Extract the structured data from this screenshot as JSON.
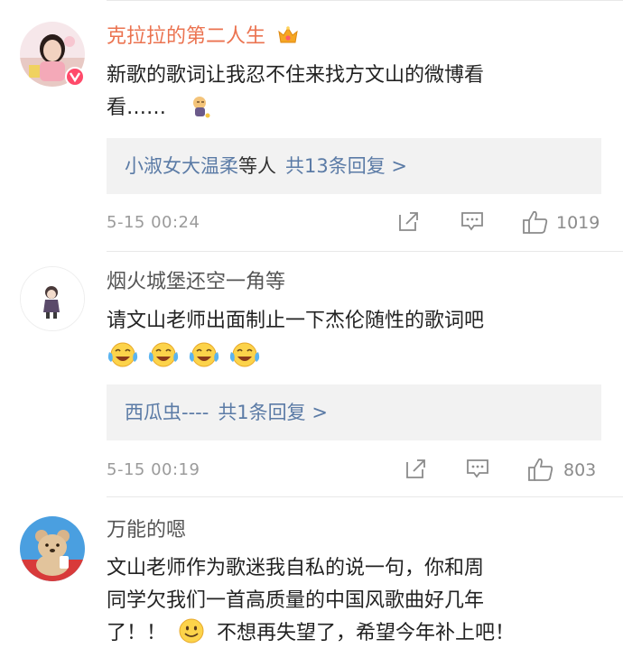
{
  "comments": [
    {
      "username": "克拉拉的第二人生",
      "text_line1": "新歌的歌词让我忍不住来找方文山的微博看",
      "text_line2": "看……",
      "reply_names": "小淑女大温柔",
      "reply_suffix": "等人",
      "reply_count": "共13条回复 >",
      "time": "5-15 00:24",
      "likes": "1019"
    },
    {
      "username": "烟火城堡还空一角等",
      "text_line1": "请文山老师出面制止一下杰伦随性的歌词吧",
      "reply_names": "西瓜虫----",
      "reply_count": "共1条回复 >",
      "time": "5-15 00:19",
      "likes": "803"
    },
    {
      "username": "万能的嗯",
      "text_line1": "文山老师作为歌迷我自私的说一句，你和周",
      "text_line2": "同学欠我们一首高质量的中国风歌曲好几年",
      "text_line3_a": "了！！",
      "text_line3_b": "不想再失望了，希望今年补上吧！"
    }
  ],
  "colors": {
    "vip_name": "#eb7350",
    "link_blue": "#5b7ba6",
    "reply_bg": "#f2f2f2",
    "meta_gray": "#9b9b9b"
  },
  "icons": [
    "vip-badge-icon",
    "crown-icon",
    "share-icon",
    "comment-icon",
    "like-icon"
  ]
}
